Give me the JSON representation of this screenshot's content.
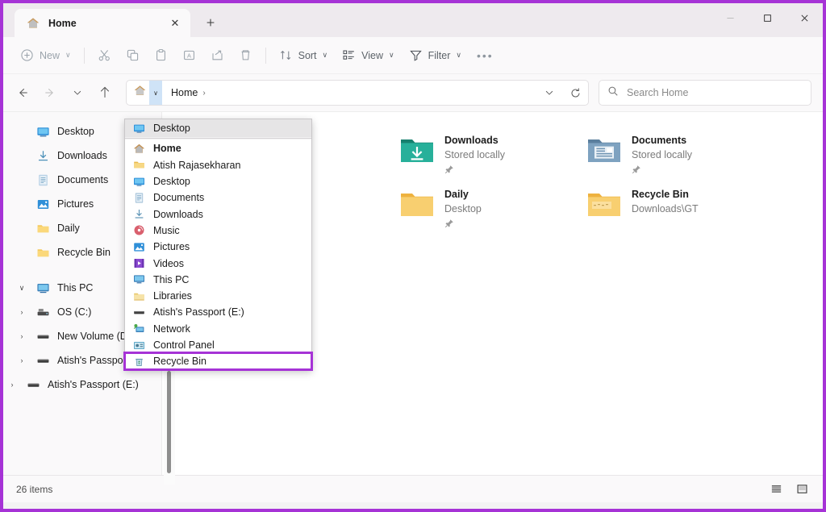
{
  "window": {
    "tab_title": "Home",
    "tab_icon": "home-icon",
    "close_tab_label": "✕",
    "new_tab_label": "＋",
    "minimize_label": "‒",
    "maximize_label": "☐",
    "close_label": "✕"
  },
  "toolbar": {
    "new_label": "New",
    "new_caret": "∨",
    "cut_label": "Cut",
    "copy_label": "Copy",
    "paste_label": "Paste",
    "rename_label": "Rename",
    "share_label": "Share",
    "delete_label": "Delete",
    "sort_label": "Sort",
    "sort_caret": "∨",
    "view_label": "View",
    "view_caret": "∨",
    "filter_label": "Filter",
    "filter_caret": "∨",
    "more_label": "•••"
  },
  "addressbar": {
    "back_label": "←",
    "forward_label": "→",
    "recent_caret": "∨",
    "up_label": "↑",
    "crumb_home": "Home",
    "crumb_sep": "›",
    "chip_caret": "∨",
    "history_caret": "∨",
    "refresh_label": "⟳",
    "search_placeholder": "Search Home",
    "search_value": ""
  },
  "dropdown": {
    "hovered_item": {
      "label": "Desktop",
      "icon": "desktop-icon"
    },
    "items": [
      {
        "label": "Home",
        "icon": "home-icon",
        "bold": true
      },
      {
        "label": "Atish Rajasekharan",
        "icon": "user-folder-icon",
        "bold": false
      },
      {
        "label": "Desktop",
        "icon": "desktop-icon",
        "bold": false
      },
      {
        "label": "Documents",
        "icon": "documents-icon",
        "bold": false
      },
      {
        "label": "Downloads",
        "icon": "downloads-icon",
        "bold": false
      },
      {
        "label": "Music",
        "icon": "music-icon",
        "bold": false
      },
      {
        "label": "Pictures",
        "icon": "pictures-icon",
        "bold": false
      },
      {
        "label": "Videos",
        "icon": "videos-icon",
        "bold": false
      },
      {
        "label": "This PC",
        "icon": "this-pc-icon",
        "bold": false
      },
      {
        "label": "Libraries",
        "icon": "libraries-icon",
        "bold": false
      },
      {
        "label": "Atish's Passport  (E:)",
        "icon": "drive-icon",
        "bold": false
      },
      {
        "label": "Network",
        "icon": "network-icon",
        "bold": false
      },
      {
        "label": "Control Panel",
        "icon": "control-panel-icon",
        "bold": false
      },
      {
        "label": "Recycle Bin",
        "icon": "recycle-bin-icon",
        "bold": false,
        "selected": true
      }
    ],
    "highlight_color": "#a633d6"
  },
  "navpane": {
    "quick_access": [
      {
        "label": "Desktop",
        "icon": "desktop-icon",
        "expandable": false
      },
      {
        "label": "Downloads",
        "icon": "downloads-icon",
        "expandable": false
      },
      {
        "label": "Documents",
        "icon": "documents-icon",
        "expandable": false
      },
      {
        "label": "Pictures",
        "icon": "pictures-icon",
        "expandable": false
      },
      {
        "label": "Daily",
        "icon": "folder-icon",
        "expandable": false
      },
      {
        "label": "Recycle Bin",
        "icon": "folder-icon",
        "expandable": false
      }
    ],
    "this_pc": {
      "label": "This PC",
      "icon": "this-pc-icon",
      "chevron": "∨"
    },
    "drives": [
      {
        "label": "OS (C:)",
        "icon": "os-drive-icon",
        "chevron": "›"
      },
      {
        "label": "New Volume (D:)",
        "icon": "drive-icon",
        "chevron": "›"
      },
      {
        "label": "Atish's Passport  (E:)",
        "icon": "drive-icon",
        "chevron": "›"
      }
    ],
    "standalone": {
      "label": "Atish's Passport  (E:)",
      "icon": "drive-icon",
      "chevron": "›"
    }
  },
  "content": {
    "tiles": [
      {
        "name": "Downloads",
        "sub": "Stored locally",
        "icon": "downloads-folder-icon",
        "pinned": true
      },
      {
        "name": "Documents",
        "sub": "Stored locally",
        "icon": "documents-folder-icon",
        "pinned": true
      },
      {
        "name": "Daily",
        "sub": "Desktop",
        "icon": "folder-icon",
        "pinned": true
      },
      {
        "name": "Recycle Bin",
        "sub": "Downloads\\GT",
        "icon": "folder-icon",
        "pinned": false
      }
    ]
  },
  "statusbar": {
    "items_text": "26 items",
    "details_view_label": "Details view",
    "large_icons_view_label": "Large icons view"
  },
  "colors": {
    "accent_purple": "#a633d6",
    "window_bg": "#faf9fa",
    "titlebar_bg": "#eeeaee"
  }
}
